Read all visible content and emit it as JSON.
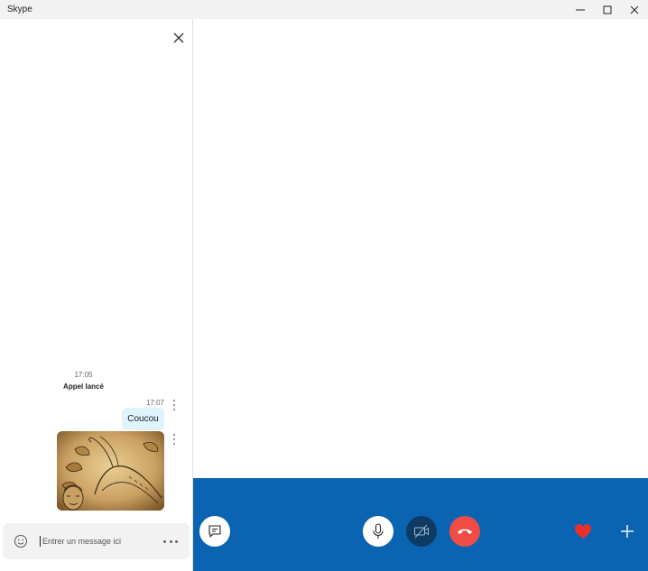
{
  "window": {
    "title": "Skype",
    "controls": [
      "minimize-icon",
      "maximize-icon",
      "close-icon"
    ]
  },
  "chat": {
    "close_icon": "close-icon",
    "system_event": {
      "time": "17:05",
      "text": "Appel lancé"
    },
    "messages": [
      {
        "time": "17:07",
        "text": "Coucou",
        "type": "text"
      },
      {
        "type": "image",
        "description_icon": "sketch-image"
      }
    ],
    "composer": {
      "placeholder": "Entrer un message ici",
      "value": "",
      "emoji_icon": "emoji-icon",
      "more_icon": "more-horizontal-icon"
    }
  },
  "call": {
    "controls": {
      "chat": "chat-icon",
      "mic": "microphone-icon",
      "video": "video-off-icon",
      "end": "end-call-icon",
      "react": "heart-icon",
      "add": "plus-icon"
    }
  },
  "colors": {
    "call_bar": "#0a64b1",
    "end_call": "#f04b44",
    "video_off_bg": "#0e3b63",
    "bubble": "#dff3fd",
    "heart": "#e8302c"
  }
}
